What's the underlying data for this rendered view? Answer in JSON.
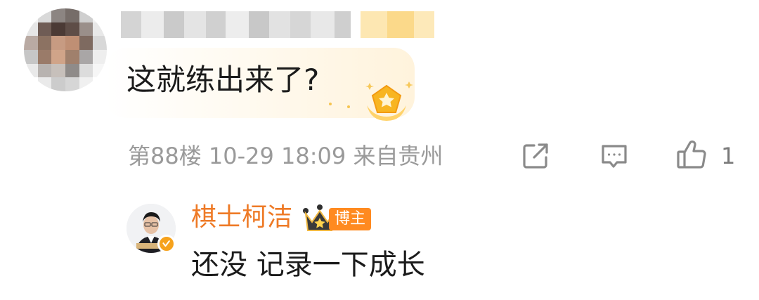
{
  "comment": {
    "text": "这就练出来了?",
    "meta": "第88楼 10-29 18:09 来自贵州",
    "like_count": "1"
  },
  "actions": {
    "share_icon": "share-external-icon",
    "reply_icon": "comment-reply-icon",
    "like_icon": "thumbs-up-icon"
  },
  "reply": {
    "author": "棋士柯洁",
    "role_badge": "博主",
    "text": "还没 记录一下成长"
  },
  "colors": {
    "author_name": "#ee7a26",
    "badge_bg": "#ff8a20",
    "meta_text": "#9a9a9a",
    "body_text": "#1b1b1b"
  }
}
